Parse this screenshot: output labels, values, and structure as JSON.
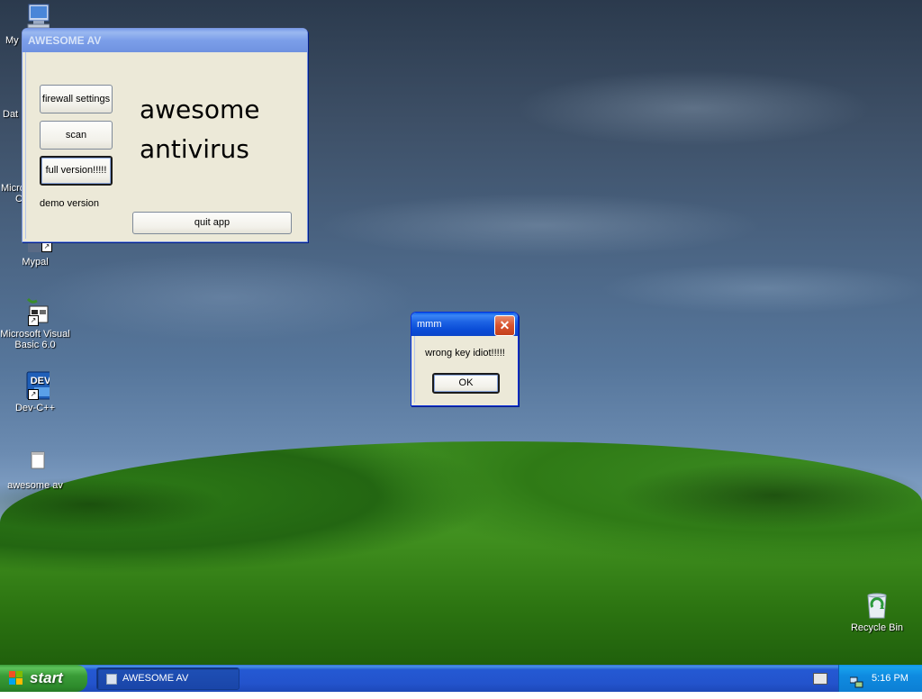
{
  "desktop": {
    "icons": [
      {
        "label": "My"
      },
      {
        "label": "Dat"
      },
      {
        "label": "Microsoft"
      },
      {
        "label": "C"
      },
      {
        "label": "Mypal"
      },
      {
        "label": "Microsoft Visual Basic 6.0"
      },
      {
        "label": "Dev-C++"
      },
      {
        "label": "awesome av"
      },
      {
        "label": "Recycle Bin"
      }
    ]
  },
  "main_window": {
    "title": "AWESOME AV",
    "buttons": {
      "firewall": "firewall settings",
      "scan": "scan",
      "full_version": "full version!!!!!",
      "quit": "quit app"
    },
    "heading_line1": "awesome",
    "heading_line2": "antivirus",
    "status": "demo version"
  },
  "dialog": {
    "title": "mmm",
    "message": "wrong key idiot!!!!!",
    "ok_label": "OK",
    "close_symbol": "✕"
  },
  "taskbar": {
    "start_label": "start",
    "task_label": "AWESOME AV",
    "time": "5:16 PM"
  },
  "colors": {
    "title_active": "#0b4ed8",
    "start_green": "#3a9c37",
    "tray_blue": "#0f8be0"
  }
}
